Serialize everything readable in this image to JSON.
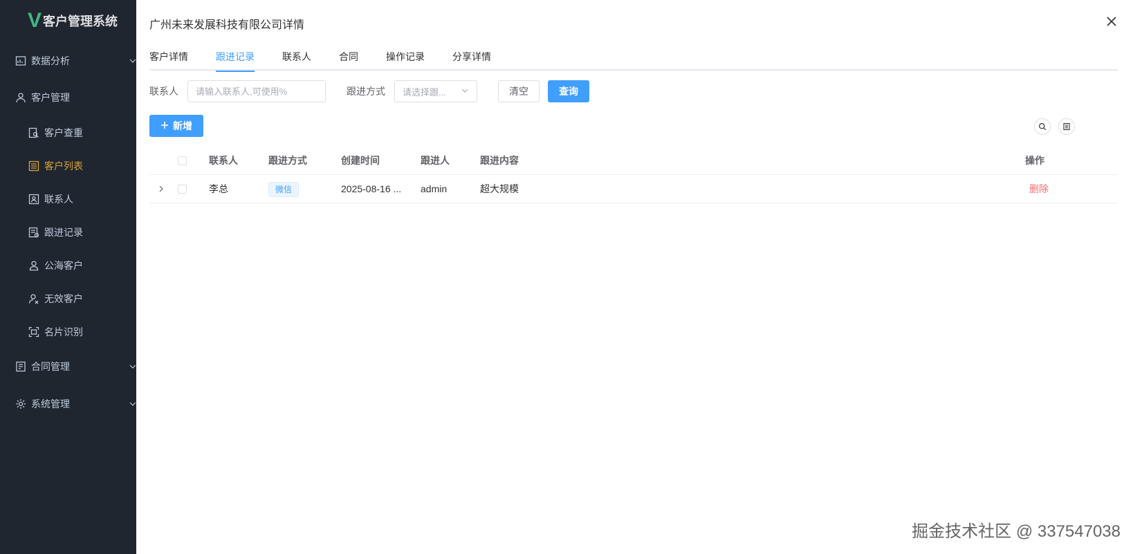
{
  "app": {
    "logo_mark": "V",
    "title": "客户管理系统"
  },
  "sidebar": {
    "items": [
      {
        "label": "数据分析",
        "icon": "chart-board-icon",
        "level": "top",
        "expandable": true
      },
      {
        "label": "客户管理",
        "icon": "user-icon",
        "level": "top",
        "expandable": false
      },
      {
        "label": "客户查重",
        "icon": "search-doc-icon",
        "level": "sub"
      },
      {
        "label": "客户列表",
        "icon": "list-icon",
        "level": "sub",
        "active": true
      },
      {
        "label": "联系人",
        "icon": "contact-card-icon",
        "level": "sub"
      },
      {
        "label": "跟进记录",
        "icon": "record-icon",
        "level": "sub"
      },
      {
        "label": "公海客户",
        "icon": "person-icon",
        "level": "sub"
      },
      {
        "label": "无效客户",
        "icon": "person-off-icon",
        "level": "sub"
      },
      {
        "label": "名片识别",
        "icon": "scan-icon",
        "level": "sub"
      },
      {
        "label": "合同管理",
        "icon": "contract-icon",
        "level": "top",
        "expandable": true
      },
      {
        "label": "系统管理",
        "icon": "gear-icon",
        "level": "top",
        "expandable": true
      }
    ]
  },
  "dialog": {
    "title": "广州未来发展科技有限公司详情",
    "tabs": [
      {
        "label": "客户详情"
      },
      {
        "label": "跟进记录",
        "active": true
      },
      {
        "label": "联系人"
      },
      {
        "label": "合同"
      },
      {
        "label": "操作记录"
      },
      {
        "label": "分享详情"
      }
    ]
  },
  "filter": {
    "contact_label": "联系人",
    "contact_placeholder": "请输入联系人,可使用%",
    "method_label": "跟进方式",
    "method_placeholder": "请选择跟...",
    "clear_label": "清空",
    "query_label": "查询"
  },
  "toolbar": {
    "add_label": "新增"
  },
  "table": {
    "headers": {
      "contact": "联系人",
      "method": "跟进方式",
      "created": "创建时间",
      "follower": "跟进人",
      "content": "跟进内容",
      "action": "操作"
    },
    "rows": [
      {
        "contact": "李总",
        "method": "微信",
        "created": "2025-08-16 ...",
        "follower": "admin",
        "content": "超大规模",
        "action": "删除"
      }
    ]
  },
  "watermark": "掘金技术社区 @ 337547038",
  "colors": {
    "primary": "#409eff",
    "danger": "#f56c6c",
    "sidebar_bg": "#1f2630",
    "active_menu": "#d9a23a",
    "logo_green": "#41b883"
  }
}
